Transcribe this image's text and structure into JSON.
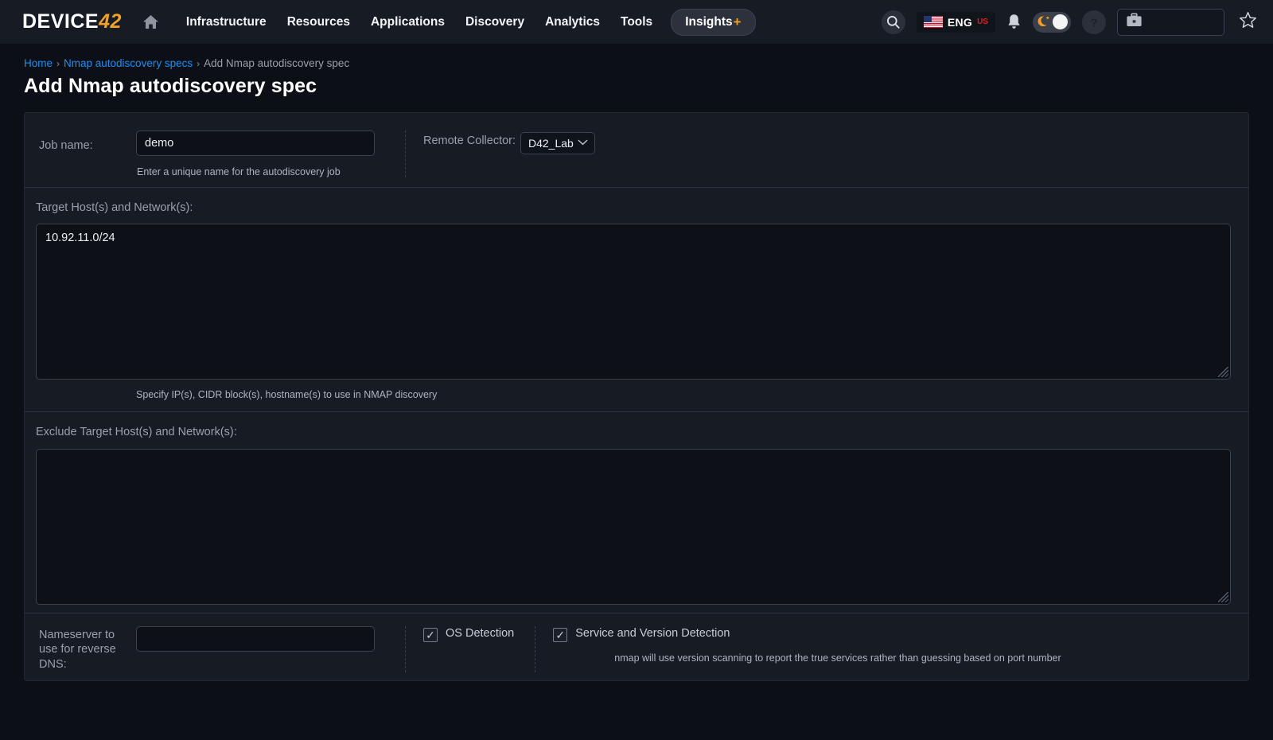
{
  "nav": {
    "logo_main": "DEVICE",
    "logo_suffix": "42",
    "home_icon": "home-icon",
    "links": [
      {
        "label": "Infrastructure"
      },
      {
        "label": "Resources"
      },
      {
        "label": "Applications"
      },
      {
        "label": "Discovery"
      },
      {
        "label": "Analytics"
      },
      {
        "label": "Tools"
      }
    ],
    "insights": {
      "label": "Insights",
      "plus": "+"
    },
    "right": {
      "search_icon": "search-icon",
      "language": "ENG",
      "language_region": "US",
      "flag_icon": "us-flag-icon",
      "bell_icon": "bell-icon",
      "theme_icon": "moon-icon",
      "help_icon": "help-icon",
      "briefcase_icon": "briefcase-icon",
      "star_icon": "star-icon"
    }
  },
  "breadcrumb": {
    "home": "Home",
    "sep": "›",
    "parent": "Nmap autodiscovery specs",
    "current": "Add Nmap autodiscovery spec"
  },
  "page_title": "Add Nmap autodiscovery spec",
  "form": {
    "job_name": {
      "label": "Job name:",
      "value": "demo",
      "placeholder": "",
      "help": "Enter a unique name for the autodiscovery job"
    },
    "remote_collector": {
      "label": "Remote Collector:",
      "value": "D42_Lab",
      "chevron": "⌄"
    },
    "target_hosts": {
      "label": "Target Host(s) and Network(s):",
      "value": "10.92.11.0/24",
      "placeholder": "",
      "help": "Specify IP(s), CIDR block(s), hostname(s) to use in NMAP discovery"
    },
    "exclude_hosts": {
      "label": "Exclude Target Host(s) and Network(s):",
      "value": "",
      "placeholder": "",
      "help": ""
    },
    "nameserver": {
      "label": "Nameserver to use for reverse DNS:",
      "value": "",
      "placeholder": ""
    },
    "os_detection": {
      "label": "OS Detection",
      "checked": true,
      "check_glyph": "✓"
    },
    "service_detection": {
      "label": "Service and Version Detection",
      "checked": true,
      "check_glyph": "✓",
      "help": "nmap will use version scanning to report the true services rather than guessing based on port number"
    }
  },
  "colors": {
    "page_bg": "#0c1016",
    "panel_bg": "#161b24",
    "nav_bg": "#161b24",
    "accent_orange": "#f0a028",
    "link_blue": "#1c8ef5",
    "input_bg": "#0d1117"
  }
}
